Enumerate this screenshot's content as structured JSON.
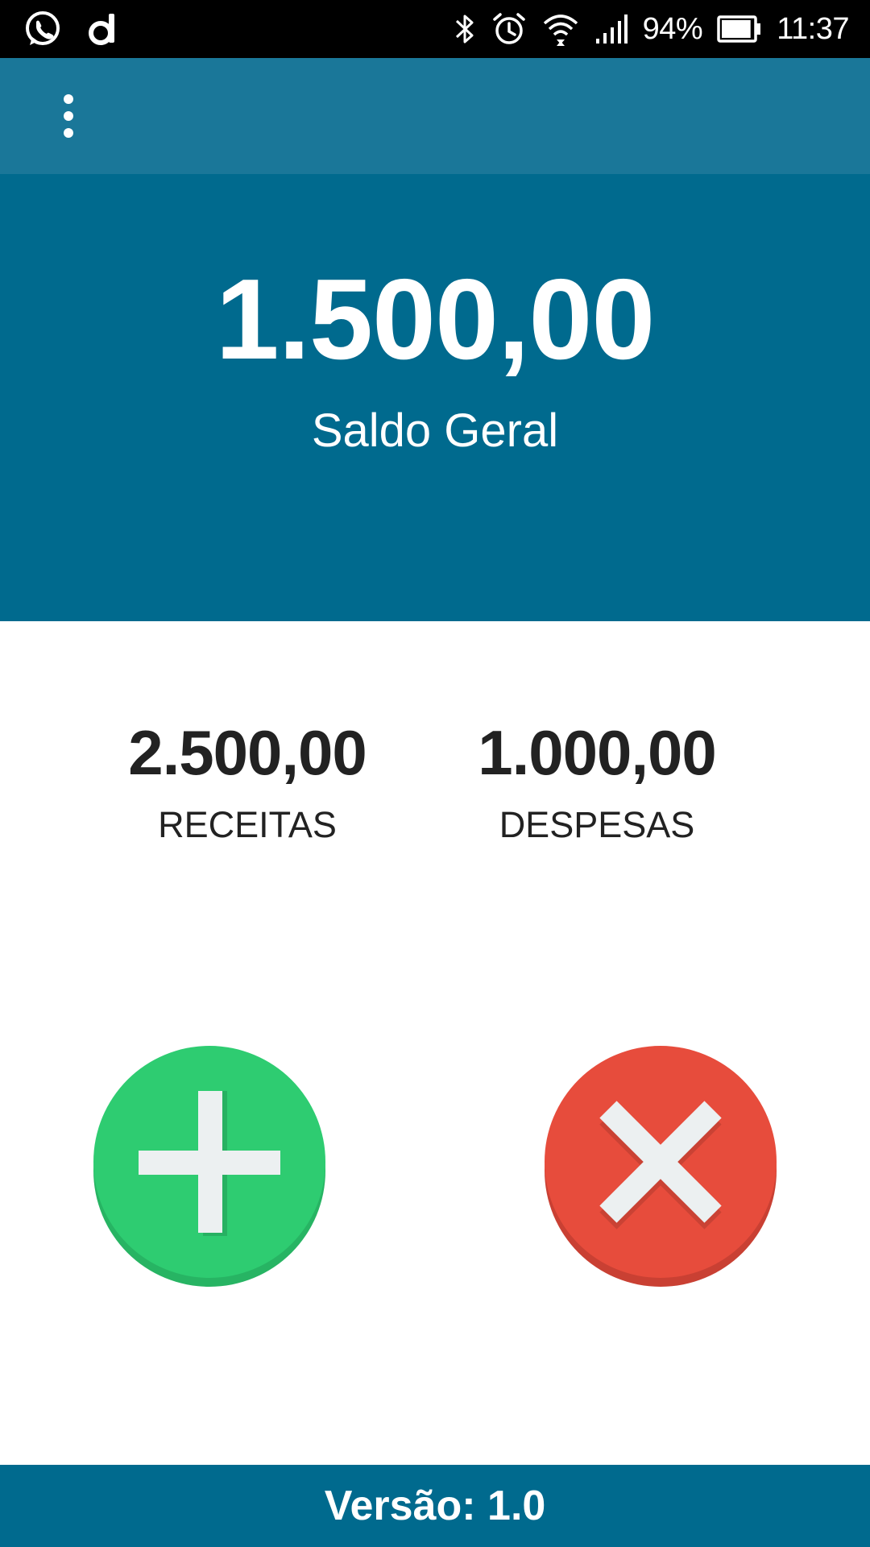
{
  "status_bar": {
    "battery": "94%",
    "time": "11:37",
    "left_icons": [
      "whatsapp-icon",
      "app-d-icon"
    ],
    "right_icons": [
      "bluetooth-icon",
      "alarm-icon",
      "wifi-icon",
      "signal-icon",
      "battery-icon"
    ],
    "battery_level": 0.94
  },
  "toolbar": {
    "menu_icon": "overflow-menu-icon"
  },
  "balance": {
    "value": "1.500,00",
    "label": "Saldo Geral"
  },
  "summary": {
    "income_value": "2.500,00",
    "income_label": "RECEITAS",
    "expense_value": "1.000,00",
    "expense_label": "DESPESAS"
  },
  "actions": {
    "add_icon": "plus-icon",
    "remove_icon": "close-icon",
    "add_color": "#2ecc71",
    "remove_color": "#e74c3c"
  },
  "footer": {
    "version": "Versão: 1.0"
  },
  "colors": {
    "status_bar": "#000000",
    "toolbar": "#1a7799",
    "primary": "#006a8e",
    "text_dark": "#222222"
  }
}
